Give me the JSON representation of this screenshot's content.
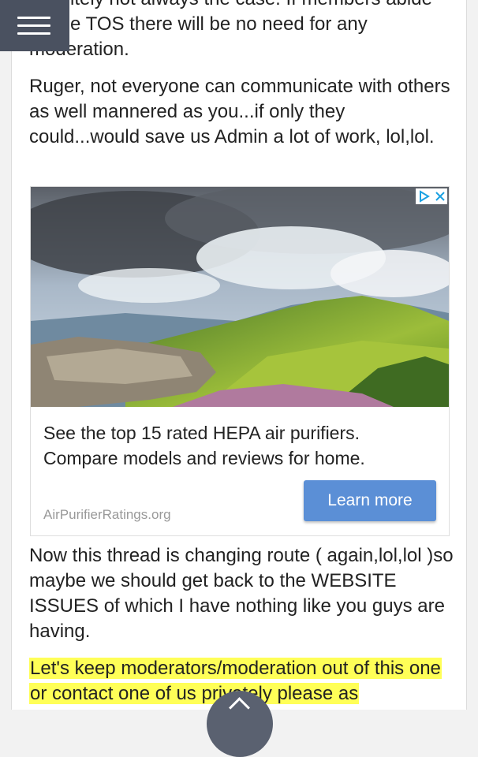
{
  "menu": {
    "icon": "hamburger-menu-icon"
  },
  "post": {
    "paragraph_partial": "definitely not always the case. If members abide by the TOS there will be no need for any moderation.",
    "paragraph_2": "Ruger, not everyone can communicate with others as well mannered as you...if only they could...would save us Admin a lot of work, lol,lol.",
    "paragraph_3": "Now this thread is changing route ( again,lol,lol )so maybe we should get back to the WEBSITE ISSUES of which I have nothing like you guys are having.",
    "highlighted": "Let's keep moderators/moderation out of this one or contact one of us privately please as",
    "highlight_color": "#ffff57"
  },
  "ad": {
    "image": "mountain-landscape",
    "choices_icon": "adchoices-icon",
    "close_icon": "close-icon",
    "text": "See the top 15 rated HEPA air purifiers. Compare models and reviews for home.",
    "source": "AirPurifierRatings.org",
    "cta_label": "Learn more",
    "cta_color": "#5b8fd6"
  },
  "scroll_top": {
    "icon": "chevron-up-icon"
  }
}
